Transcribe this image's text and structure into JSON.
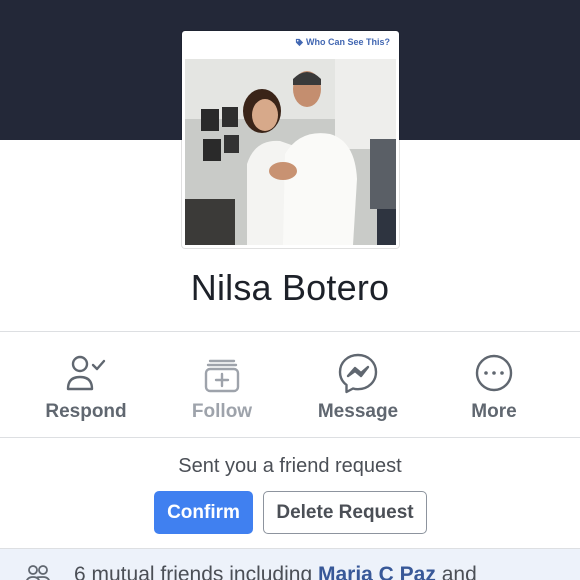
{
  "profile": {
    "privacy_label": "Who Can See This?",
    "privacy_icon": "tag-icon",
    "name": "Nilsa Botero",
    "photo_alt": "Profile photo"
  },
  "actions": [
    {
      "label": "Respond",
      "icon": "person-check-icon",
      "enabled": true
    },
    {
      "label": "Follow",
      "icon": "follow-plus-icon",
      "enabled": false
    },
    {
      "label": "Message",
      "icon": "messenger-icon",
      "enabled": true
    },
    {
      "label": "More",
      "icon": "more-dots-icon",
      "enabled": true
    }
  ],
  "friend_request": {
    "text": "Sent you a friend request",
    "confirm_label": "Confirm",
    "delete_label": "Delete Request"
  },
  "mutual": {
    "icon": "friends-icon",
    "prefix": "6 mutual friends including ",
    "friend_name": "Maria C Paz",
    "suffix": " and"
  },
  "colors": {
    "cover": "#232838",
    "accent": "#4080f0",
    "link": "#385898",
    "mutual_bg": "#edf2fa"
  }
}
